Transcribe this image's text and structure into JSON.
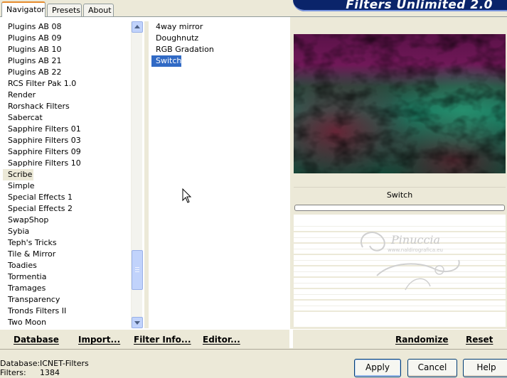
{
  "tabs": [
    {
      "label": "Navigator",
      "active": true
    },
    {
      "label": "Presets",
      "active": false
    },
    {
      "label": "About",
      "active": false
    }
  ],
  "banner": {
    "title": "Filters Unlimited 2.0"
  },
  "categories": {
    "items": [
      "Plugins AB 08",
      "Plugins AB 09",
      "Plugins AB 10",
      "Plugins AB 21",
      "Plugins AB 22",
      "RCS Filter Pak 1.0",
      "Render",
      "Rorshack Filters",
      "Sabercat",
      "Sapphire Filters 01",
      "Sapphire Filters 03",
      "Sapphire Filters 09",
      "Sapphire Filters 10",
      "Scribe",
      "Simple",
      "Special Effects 1",
      "Special Effects 2",
      "SwapShop",
      "Sybia",
      "Teph's Tricks",
      "Tile & Mirror",
      "Toadies",
      "Tormentia",
      "Tramages",
      "Transparency",
      "Tronds Filters II",
      "Two Moon"
    ],
    "selected": "Scribe"
  },
  "filters": {
    "items": [
      "4way mirror",
      "Doughnutz",
      "RGB Gradation",
      "Switch"
    ],
    "selected": "Switch"
  },
  "preview": {
    "filter_name": "Switch"
  },
  "watermark": {
    "name": "Pinuccia",
    "url": "www.naldirografica.eu"
  },
  "toolbar": {
    "database_label": "Database",
    "import_label": "Import...",
    "filter_info_label": "Filter Info...",
    "editor_label": "Editor...",
    "randomize_label": "Randomize",
    "reset_label": "Reset"
  },
  "status": {
    "database_label": "Database:",
    "database_value": "ICNET-Filters",
    "filters_label": "Filters:",
    "filters_value": "1384"
  },
  "buttons": {
    "apply_label": "Apply",
    "cancel_label": "Cancel",
    "help_label": "Help"
  },
  "colors": {
    "selection": "#316ac5",
    "banner": "#0a246a",
    "face": "#ece9d8"
  }
}
